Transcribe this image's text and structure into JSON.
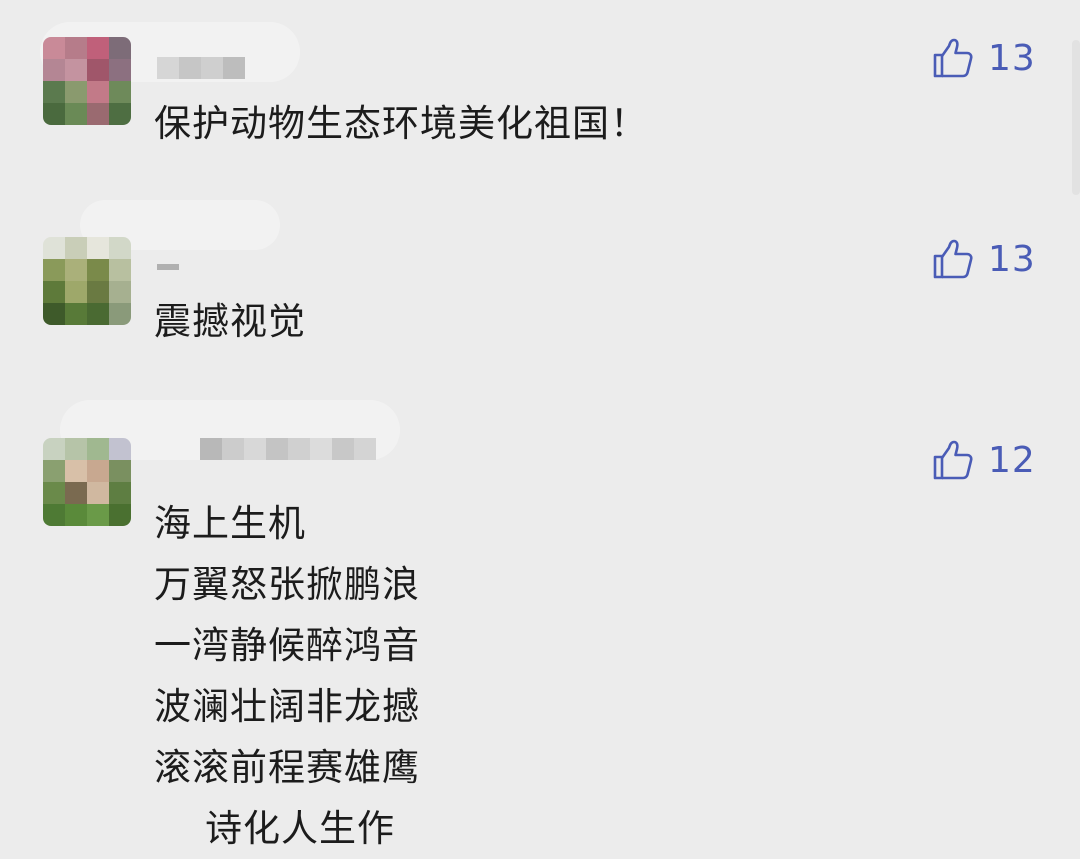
{
  "comments": [
    {
      "text": "保护动物生态环境美化祖国！",
      "likes": "13",
      "avatar_colors": [
        "#c98a98",
        "#b67c8a",
        "#c0607a",
        "#7d6c78",
        "#b48694",
        "#c493a0",
        "#a0566a",
        "#8c7080",
        "#5b7a4e",
        "#8a9a6e",
        "#c27a88",
        "#6e8a5a",
        "#4a6a3e",
        "#6a8a56",
        "#9a6a70",
        "#4e6e42"
      ],
      "name_colors": [
        "#d6d6d6",
        "#c6c6c6",
        "#cfcfcf",
        "#bdbdbd"
      ]
    },
    {
      "text": "震撼视觉",
      "likes": "13",
      "avatar_colors": [
        "#dfe2d8",
        "#c9ceb8",
        "#e6e6dc",
        "#d2d8c8",
        "#8a9a5a",
        "#aab07a",
        "#7a8a4a",
        "#b8c0a0",
        "#5e7a3a",
        "#9ea86a",
        "#6a7a42",
        "#a6b090",
        "#3e5a2a",
        "#587a38",
        "#4a6a32",
        "#8a9a7a"
      ],
      "name_colors": [
        "#b0b0b0"
      ]
    },
    {
      "text": "海上生机\n万翼怒张掀鹏浪\n一湾静候醉鸿音\n波澜壮阔非龙撼\n滚滚前程赛雄鹰\n    诗化人生作",
      "likes": "12",
      "avatar_colors": [
        "#c8d2c0",
        "#b6c4a8",
        "#a0b890",
        "#c2c2d0",
        "#8aa070",
        "#d8c0a8",
        "#c8a890",
        "#7a9060",
        "#6a8a4a",
        "#7a6a50",
        "#d0b8a0",
        "#5e7e42",
        "#4e7a34",
        "#5a8a3a",
        "#6a9a48",
        "#4a7030"
      ],
      "name_colors": [
        "#b8b8b8",
        "#cccccc",
        "#d8d8d8",
        "#c4c4c4",
        "#d0d0d0",
        "#dcdcdc",
        "#c8c8c8",
        "#d4d4d4"
      ]
    }
  ],
  "icons": {
    "like": "thumbs-up-icon"
  },
  "colors": {
    "background": "#ececec",
    "like_accent": "#4a5cb6"
  }
}
